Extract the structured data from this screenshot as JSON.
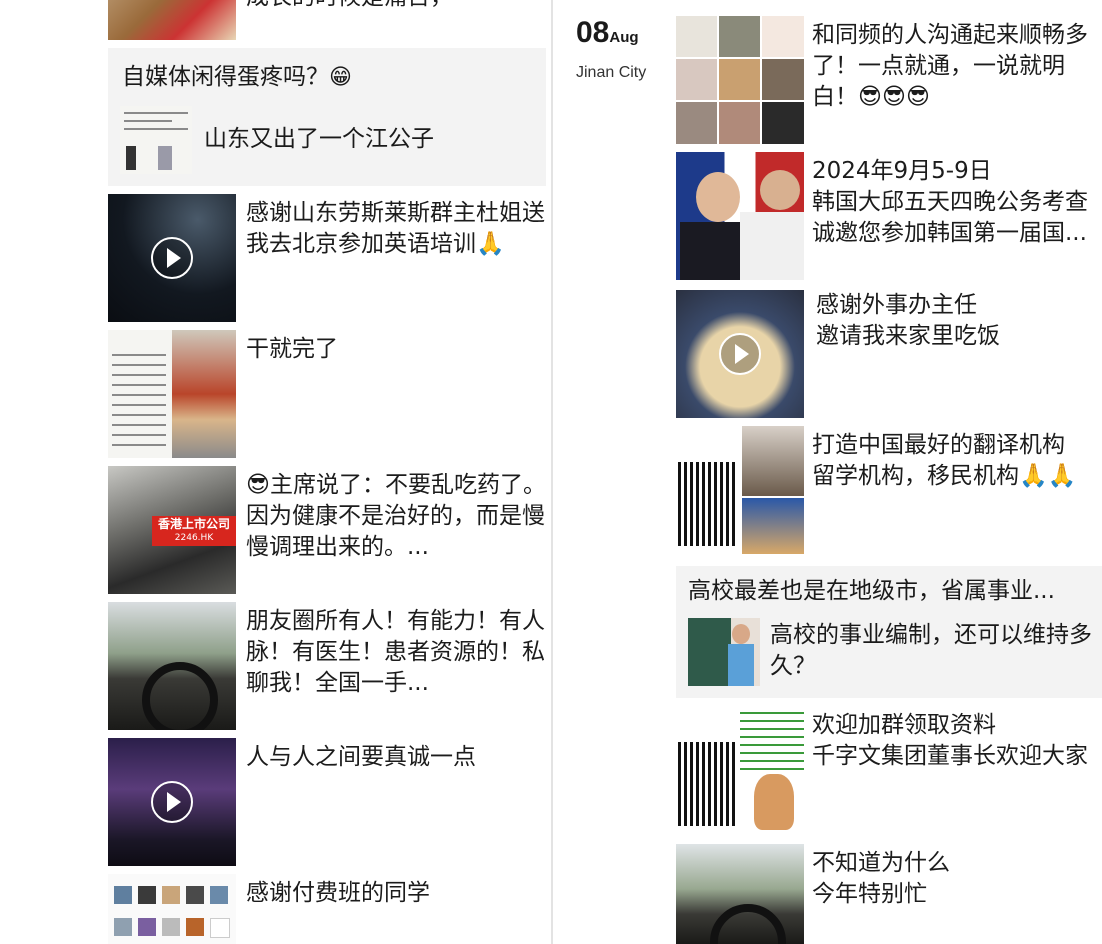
{
  "left_column": {
    "posts": [
      {
        "text": "成长的时候是痛苦，"
      },
      {
        "shared_title": "自媒体闲得蛋疼吗？",
        "shared_emoji": "😁",
        "link_text": "山东又出了一个江公子"
      },
      {
        "text": "感谢山东劳斯莱斯群主杜姐送我去北京参加英语培训🙏"
      },
      {
        "text": "干就完了"
      },
      {
        "text": "😎主席说了：不要乱吃药了。因为健康不是治好的，而是慢慢调理出来的。..."
      },
      {
        "text": "朋友圈所有人！有能力！有人脉！有医生！患者资源的！私聊我！全国一手..."
      },
      {
        "text": "人与人之间要真诚一点"
      },
      {
        "text": "感谢付费班的同学"
      }
    ],
    "sticker_text": "香港上市公司",
    "sticker_sub": "2246.HK"
  },
  "right_column": {
    "date_day": "08",
    "date_month": "Aug",
    "city": "Jinan City",
    "posts": [
      {
        "text": "和同频的人沟通起来顺畅多了！一点就通，一说就明白！😎😎😎"
      },
      {
        "text": "2024年9月5-9日\n韩国大邱五天四晚公务考查\n诚邀您参加韩国第一届国..."
      },
      {
        "text": "感谢外事办主任\n邀请我来家里吃饭"
      },
      {
        "text": "打造中国最好的翻译机构\n留学机构，移民机构🙏🙏"
      },
      {
        "shared_title": "高校最差也是在地级市，省属事业...",
        "link_text": "高校的事业编制，还可以维持多久？"
      },
      {
        "text": "欢迎加群领取资料\n千字文集团董事长欢迎大家"
      },
      {
        "text": "不知道为什么\n今年特别忙"
      }
    ]
  },
  "icons": {
    "play": "play-icon"
  },
  "colors": {
    "shared_bg": "#f3f3f3",
    "divider": "#e3e3e3",
    "text": "#1c1c1c"
  }
}
